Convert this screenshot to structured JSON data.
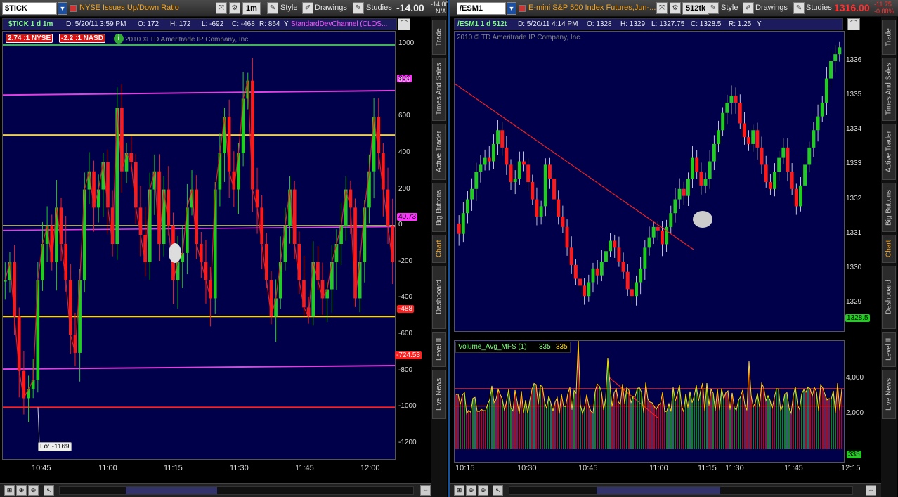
{
  "left": {
    "symbol": "$TICK",
    "description": "NYSE Issues Up/Down Ratio",
    "aggregation": "1m",
    "style_label": "Style",
    "drawings_label": "Drawings",
    "studies_label": "Studies",
    "last_value": "-14.00",
    "mini_top": "-14.00",
    "mini_bottom": "N/A",
    "info": {
      "name": "$TICK 1 d 1m",
      "date": "D: 5/20/11 3:59 PM",
      "open": "O: 172",
      "high": "H: 172",
      "low": "L: -692",
      "close": "C: -468",
      "range": "R: 864",
      "y": "Y:",
      "study": "StandardDevChannel (CLOS..."
    },
    "badge_nyse": "2.74 :1 NYSE",
    "badge_nasd": "-2.2 :1 NASD",
    "copyright": "2010 © TD Ameritrade IP Company, Inc.",
    "y_ticks": [
      "1000",
      "800",
      "600",
      "400",
      "200",
      "0",
      "-200",
      "-400",
      "-600",
      "-800",
      "-1000",
      "-1200"
    ],
    "x_ticks": [
      "10:45",
      "11:00",
      "11:15",
      "11:30",
      "11:45",
      "12:00"
    ],
    "tags": {
      "upper": "806",
      "current": "40.73",
      "lower_yellow": "-488",
      "lower": "-724.53"
    },
    "low_label": "Lo: -1169"
  },
  "right": {
    "symbol": "/ESM1",
    "description": "E-mini S&P 500 Index Futures,Jun-...",
    "aggregation": "512tk",
    "style_label": "Style",
    "drawings_label": "Drawings",
    "studies_label": "Studies",
    "last_value": "1316.00",
    "mini_top": "-11.75",
    "mini_bottom": "-0.88%",
    "info": {
      "name": "/ESM1 1 d 512t",
      "date": "D: 5/20/11 4:14 PM",
      "open": "O: 1328",
      "high": "H: 1329",
      "low": "L: 1327.75",
      "close": "C: 1328.5",
      "range": "R: 1.25",
      "y": "Y:"
    },
    "copyright": "2010 © TD Ameritrade IP Company, Inc.",
    "y_ticks": [
      "1336",
      "1335",
      "1334",
      "1333",
      "1332",
      "1331",
      "1330",
      "1329"
    ],
    "price_tag": "1328.5",
    "volume_study": "Volume_Avg_MFS (1)",
    "volume_v1": "335",
    "volume_v2": "335",
    "volume_y_ticks": [
      "4,000",
      "2,000"
    ],
    "volume_tag": "335",
    "x_ticks": [
      "10:15",
      "10:30",
      "10:45",
      "11:00",
      "11:15",
      "11:30",
      "11:45",
      "12:15"
    ]
  },
  "side_tabs": [
    "Trade",
    "Times And Sales",
    "Active Trader",
    "Big Buttons",
    "Chart",
    "Dashboard",
    "Level II",
    "Live News"
  ],
  "colors": {
    "chart_bg": "#00004a",
    "up": "#22cc22",
    "down": "#ff1a1a",
    "magenta": "#e040e0",
    "yellow": "#ffd700",
    "red_line": "#ff2020"
  }
}
